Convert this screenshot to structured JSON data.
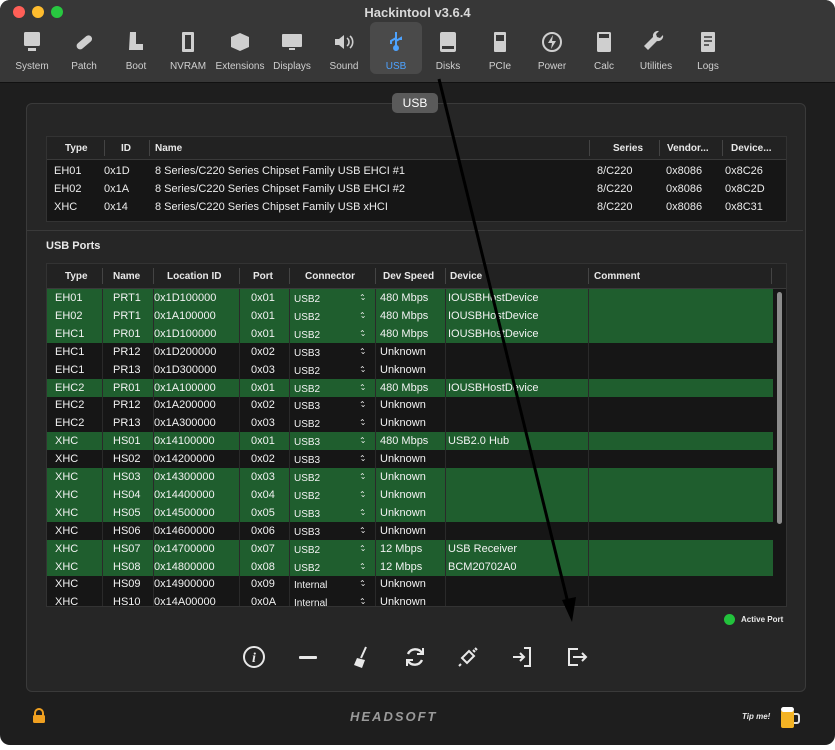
{
  "window": {
    "title": "Hackintool v3.6.4"
  },
  "toolbar": {
    "items": [
      {
        "label": "System",
        "icon": "computer-icon"
      },
      {
        "label": "Patch",
        "icon": "bandage-icon"
      },
      {
        "label": "Boot",
        "icon": "boot-icon"
      },
      {
        "label": "NVRAM",
        "icon": "memory-icon"
      },
      {
        "label": "Extensions",
        "icon": "box-icon"
      },
      {
        "label": "Displays",
        "icon": "display-icon"
      },
      {
        "label": "Sound",
        "icon": "speaker-icon"
      },
      {
        "label": "USB",
        "icon": "usb-icon"
      },
      {
        "label": "Disks",
        "icon": "disk-icon"
      },
      {
        "label": "PCIe",
        "icon": "pcie-icon"
      },
      {
        "label": "Power",
        "icon": "power-icon"
      },
      {
        "label": "Calc",
        "icon": "calculator-icon"
      },
      {
        "label": "Utilities",
        "icon": "wrench-icon"
      },
      {
        "label": "Logs",
        "icon": "log-icon"
      }
    ],
    "active": "USB"
  },
  "panel": {
    "tab_label": "USB"
  },
  "controllers": {
    "columns": [
      "Type",
      "ID",
      "Name",
      "Series",
      "Vendor...",
      "Device..."
    ],
    "rows": [
      [
        "EH01",
        "0x1D",
        "8 Series/C220 Series Chipset Family USB EHCI #1",
        "8/C220",
        "0x8086",
        "0x8C26"
      ],
      [
        "EH02",
        "0x1A",
        "8 Series/C220 Series Chipset Family USB EHCI #2",
        "8/C220",
        "0x8086",
        "0x8C2D"
      ],
      [
        "XHC",
        "0x14",
        "8 Series/C220 Series Chipset Family USB xHCI",
        "8/C220",
        "0x8086",
        "0x8C31"
      ]
    ]
  },
  "usb_ports": {
    "section_title": "USB Ports",
    "columns": [
      "Type",
      "Name",
      "Location ID",
      "Port",
      "Connector",
      "Dev Speed",
      "Device",
      "Comment"
    ],
    "rows": [
      {
        "type": "EH01",
        "name": "PRT1",
        "location": "0x1D100000",
        "port": "0x01",
        "connector": "USB2",
        "speed": "480 Mbps",
        "device": "IOUSBHostDevice",
        "active": true
      },
      {
        "type": "EH02",
        "name": "PRT1",
        "location": "0x1A100000",
        "port": "0x01",
        "connector": "USB2",
        "speed": "480 Mbps",
        "device": "IOUSBHostDevice",
        "active": true
      },
      {
        "type": "EHC1",
        "name": "PR01",
        "location": "0x1D100000",
        "port": "0x01",
        "connector": "USB2",
        "speed": "480 Mbps",
        "device": "IOUSBHostDevice",
        "active": true
      },
      {
        "type": "EHC1",
        "name": "PR12",
        "location": "0x1D200000",
        "port": "0x02",
        "connector": "USB3",
        "speed": "Unknown",
        "device": "",
        "active": false
      },
      {
        "type": "EHC1",
        "name": "PR13",
        "location": "0x1D300000",
        "port": "0x03",
        "connector": "USB2",
        "speed": "Unknown",
        "device": "",
        "active": false
      },
      {
        "type": "EHC2",
        "name": "PR01",
        "location": "0x1A100000",
        "port": "0x01",
        "connector": "USB2",
        "speed": "480 Mbps",
        "device": "IOUSBHostDevice",
        "active": true
      },
      {
        "type": "EHC2",
        "name": "PR12",
        "location": "0x1A200000",
        "port": "0x02",
        "connector": "USB3",
        "speed": "Unknown",
        "device": "",
        "active": false
      },
      {
        "type": "EHC2",
        "name": "PR13",
        "location": "0x1A300000",
        "port": "0x03",
        "connector": "USB2",
        "speed": "Unknown",
        "device": "",
        "active": false
      },
      {
        "type": "XHC",
        "name": "HS01",
        "location": "0x14100000",
        "port": "0x01",
        "connector": "USB3",
        "speed": "480 Mbps",
        "device": "USB2.0 Hub",
        "active": true
      },
      {
        "type": "XHC",
        "name": "HS02",
        "location": "0x14200000",
        "port": "0x02",
        "connector": "USB3",
        "speed": "Unknown",
        "device": "",
        "active": false
      },
      {
        "type": "XHC",
        "name": "HS03",
        "location": "0x14300000",
        "port": "0x03",
        "connector": "USB2",
        "speed": "Unknown",
        "device": "",
        "active": true
      },
      {
        "type": "XHC",
        "name": "HS04",
        "location": "0x14400000",
        "port": "0x04",
        "connector": "USB2",
        "speed": "Unknown",
        "device": "",
        "active": true
      },
      {
        "type": "XHC",
        "name": "HS05",
        "location": "0x14500000",
        "port": "0x05",
        "connector": "USB3",
        "speed": "Unknown",
        "device": "",
        "active": true
      },
      {
        "type": "XHC",
        "name": "HS06",
        "location": "0x14600000",
        "port": "0x06",
        "connector": "USB3",
        "speed": "Unknown",
        "device": "",
        "active": false
      },
      {
        "type": "XHC",
        "name": "HS07",
        "location": "0x14700000",
        "port": "0x07",
        "connector": "USB2",
        "speed": "12 Mbps",
        "device": "USB Receiver",
        "active": true
      },
      {
        "type": "XHC",
        "name": "HS08",
        "location": "0x14800000",
        "port": "0x08",
        "connector": "USB2",
        "speed": "12 Mbps",
        "device": "BCM20702A0",
        "active": true
      },
      {
        "type": "XHC",
        "name": "HS09",
        "location": "0x14900000",
        "port": "0x09",
        "connector": "Internal",
        "speed": "Unknown",
        "device": "",
        "active": false
      },
      {
        "type": "XHC",
        "name": "HS10",
        "location": "0x14A00000",
        "port": "0x0A",
        "connector": "Internal",
        "speed": "Unknown",
        "device": "",
        "active": false
      }
    ]
  },
  "legend": {
    "label": "Active Port",
    "color": "#22c23c"
  },
  "actions": [
    {
      "name": "info-button",
      "icon": "info-icon"
    },
    {
      "name": "remove-button",
      "icon": "minus-icon"
    },
    {
      "name": "clear-button",
      "icon": "broom-icon"
    },
    {
      "name": "refresh-button",
      "icon": "refresh-icon"
    },
    {
      "name": "inject-button",
      "icon": "syringe-icon"
    },
    {
      "name": "import-button",
      "icon": "import-icon"
    },
    {
      "name": "export-button",
      "icon": "export-icon"
    }
  ],
  "footer": {
    "logo": "HEADSOFT",
    "tip": "Tip me!"
  },
  "colors": {
    "active_row": "#1f5e2e",
    "accent": "#4ea3ff"
  }
}
